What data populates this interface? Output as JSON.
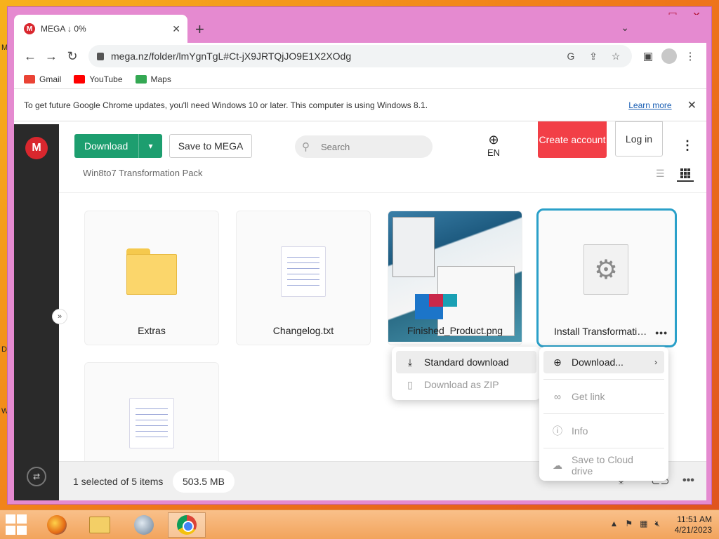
{
  "browser": {
    "tab_title": "MEGA ↓ 0%",
    "tab_favicon": "M",
    "url": "mega.nz/folder/lmYgnTgL#Ct-jX9JRTQjJO9E1X2XOdg",
    "bookmarks": [
      {
        "label": "Gmail",
        "color": "#ea4335"
      },
      {
        "label": "YouTube",
        "color": "#ff0000"
      },
      {
        "label": "Maps",
        "color": "#34a853"
      }
    ],
    "infobar": {
      "text": "To get future Google Chrome updates, you'll need Windows 10 or later. This computer is using Windows 8.1.",
      "link": "Learn more"
    }
  },
  "mega": {
    "logo": "M",
    "download_label": "Download",
    "save_label": "Save to MEGA",
    "search_placeholder": "Search",
    "language": "EN",
    "create_account": "Create account",
    "login": "Log in",
    "breadcrumb": "Win8to7 Transformation Pack",
    "items": [
      {
        "name": "Extras",
        "type": "folder"
      },
      {
        "name": "Changelog.txt",
        "type": "text"
      },
      {
        "name": "Finished_Product.png",
        "type": "image"
      },
      {
        "name": "Install Transformation Pack",
        "type": "executable",
        "selected": true
      },
      {
        "name": "",
        "type": "text"
      }
    ],
    "context_menu": {
      "download": "Download...",
      "get_link": "Get link",
      "info": "Info",
      "save_cloud": "Save to Cloud drive"
    },
    "download_submenu": {
      "standard": "Standard download",
      "zip": "Download as ZIP"
    },
    "status": {
      "selection": "1 selected of 5 items",
      "size": "503.5 MB"
    }
  },
  "taskbar": {
    "time": "11:51 AM",
    "date": "4/21/2023"
  },
  "colors": {
    "mega_red": "#d9272e",
    "download_green": "#1d9e6f",
    "create_red": "#f23f47",
    "selection_blue": "#2aa0c9"
  }
}
